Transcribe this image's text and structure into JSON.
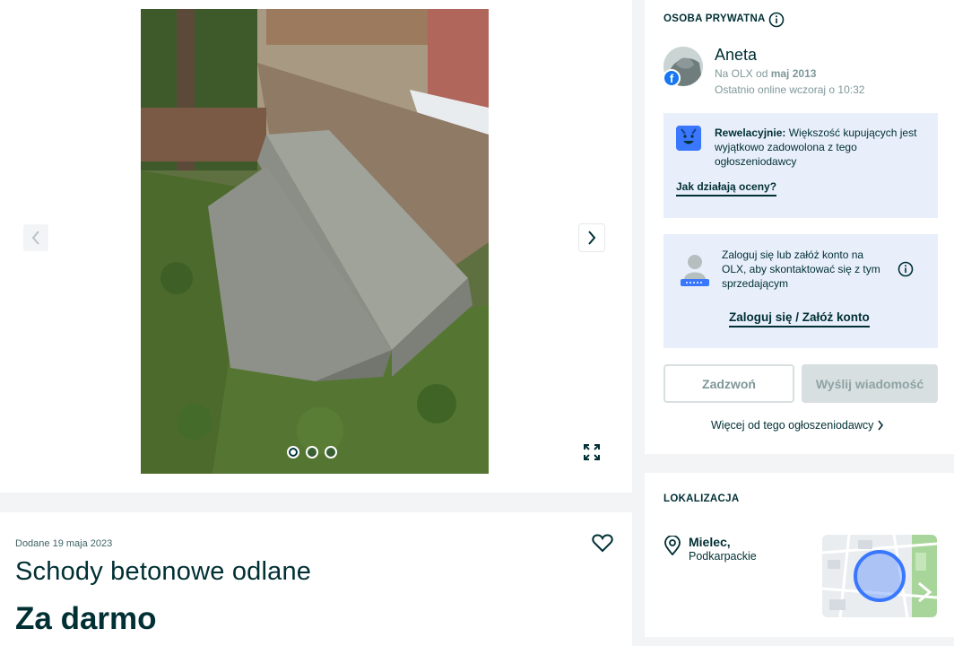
{
  "gallery": {
    "photo_alt": "",
    "slides_total": 3,
    "active_slide": 1
  },
  "listing": {
    "date_added": "Dodane 19 maja 2023",
    "title": "Schody betonowe odlane",
    "price": "Za darmo"
  },
  "seller": {
    "section_label": "OSOBA PRYWATNA",
    "name": "Aneta",
    "since_prefix": "Na OLX od ",
    "since_value": "maj 2013",
    "online": "Ostatnio online wczoraj o 10:32",
    "rating_bold": "Rewelacyjnie:",
    "rating_text": " Większość kupujących jest wyjątkowo zadowolona z tego ogłoszeniodawcy",
    "rating_link": "Jak działają oceny?",
    "login_text": "Zaloguj się lub załóż konto na OLX, aby skontaktować się z tym sprzedającym",
    "login_link": "Zaloguj się / Załóż konto",
    "call_button": "Zadzwoń",
    "message_button": "Wyślij wiadomość",
    "more_link": "Więcej od tego ogłoszeniodawcy"
  },
  "location": {
    "section_label": "LOKALIZACJA",
    "city": "Mielec,",
    "region": "Podkarpackie"
  },
  "colors": {
    "primary": "#002f34",
    "info_box": "#e8effb",
    "accent_blue": "#3a77ff",
    "facebook": "#1877f2"
  },
  "icons": [
    "chevron-left-icon",
    "chevron-right-icon",
    "expand-icon",
    "heart-icon",
    "info-icon",
    "facebook-icon",
    "smile-icon",
    "user-lock-icon",
    "chevron-right-small-icon",
    "location-pin-icon"
  ]
}
